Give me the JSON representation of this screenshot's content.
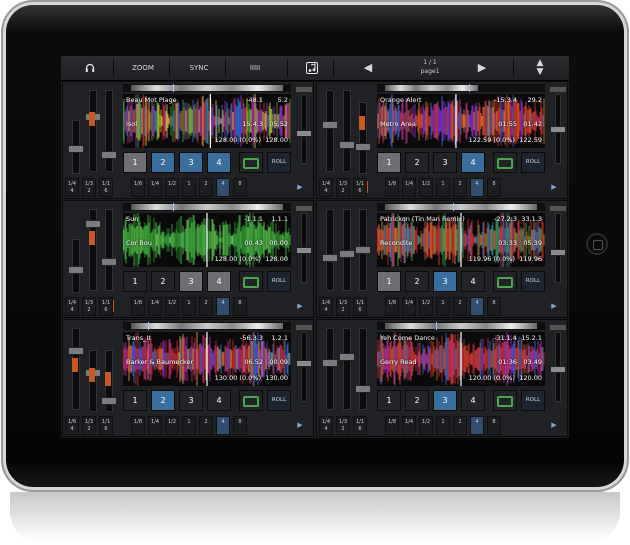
{
  "toolbar": {
    "headphones_icon": "headphones-icon",
    "zoom_label": "ZOOM",
    "sync_label": "SYNC",
    "levels_label": "IIIII",
    "music_icon": "music-note-icon",
    "prev_icon": "triangle-left-icon",
    "page_number": "1 / 1",
    "page_name": "page1",
    "next_icon": "triangle-right-icon",
    "updown_icon": "up-down-arrows-icon"
  },
  "colors": {
    "orange": "#c85a1d",
    "blue_pad": "#3a6e9c",
    "gray_pad": "#6e6f73",
    "loop_green": "#49a64c"
  },
  "decks": [
    {
      "title": "Beau Mot Plage",
      "artist": "Isol",
      "time_elapsed": "-48.1",
      "time_total": "5.2",
      "time_remaining": "15.4.3",
      "time_mid": "05.52",
      "bpm_left": "128.00 (0.0%)",
      "bpm_right": "128.00",
      "pads": [
        "1",
        "2",
        "3",
        "4"
      ],
      "pad_styles": [
        "gray",
        "blue",
        "blue",
        "blue"
      ],
      "roll_label": "ROLL",
      "loop_sizes": [
        "1/4 4",
        "1/3 2",
        "1/1 6",
        "1/8",
        "1/4",
        "1/2",
        "1",
        "2",
        "4",
        "8"
      ],
      "selected_loop_index": 8,
      "headphone_active": false
    },
    {
      "title": "Orange Alert",
      "artist": "Metro Area",
      "time_elapsed": "-15.3.4",
      "time_total": "29.2",
      "time_remaining": "01:55",
      "time_mid": "01.42",
      "bpm_left": "122.59 (0.0%)",
      "bpm_right": "122.59",
      "pads": [
        "1",
        "2",
        "3",
        "4"
      ],
      "pad_styles": [
        "gray",
        "dark",
        "dark",
        "blue"
      ],
      "roll_label": "ROLL",
      "loop_sizes": [
        "1/4 4",
        "1/3 2",
        "1/1 6",
        "1/8",
        "1/4",
        "1/2",
        "1",
        "2",
        "4",
        "8"
      ],
      "selected_loop_index": 8,
      "headphone_active": true
    },
    {
      "title": "Sun",
      "artist": "Cor Bou",
      "time_elapsed": "-1.1.1",
      "time_total": "1.1.1",
      "time_remaining": "00.43",
      "time_mid": "00.00",
      "bpm_left": "128.00 (0.0%)",
      "bpm_right": "128.00",
      "pads": [
        "1",
        "2",
        "3",
        "4"
      ],
      "pad_styles": [
        "dark",
        "dark",
        "gray",
        "gray"
      ],
      "roll_label": "ROLL",
      "loop_sizes": [
        "1/4 4",
        "1/3 2",
        "1/1 6",
        "1/8",
        "1/4",
        "1/2",
        "1",
        "2",
        "4",
        "8"
      ],
      "selected_loop_index": 8,
      "headphone_active": true
    },
    {
      "title": "Patrickon (Tin Man Remix)",
      "artist": "Recondite",
      "time_elapsed": "-27.2.3",
      "time_total": "33.1.3",
      "time_remaining": "03:33",
      "time_mid": "05.39",
      "bpm_left": "119.96 (0.0%)",
      "bpm_right": "119.96",
      "pads": [
        "1",
        "2",
        "3",
        "4"
      ],
      "pad_styles": [
        "gray",
        "dark",
        "blue",
        "dark"
      ],
      "roll_label": "ROLL",
      "loop_sizes": [
        "1/4 4",
        "1/3 2",
        "1/1 6",
        "1/8",
        "1/4",
        "1/2",
        "1",
        "2",
        "4",
        "8"
      ],
      "selected_loop_index": 8,
      "headphone_active": false
    },
    {
      "title": "Trans_It",
      "artist": "Barker & Baumecker",
      "time_elapsed": "-56.3.3",
      "time_total": "1.2.1",
      "time_remaining": "06.52",
      "time_mid": "00.09",
      "bpm_left": "130.00 (0.0%)",
      "bpm_right": "130.00",
      "pads": [
        "1",
        "2",
        "3",
        "4"
      ],
      "pad_styles": [
        "dark",
        "blue",
        "dark",
        "dark"
      ],
      "roll_label": "ROLL",
      "loop_sizes": [
        "1/6 4",
        "1/3 2",
        "1/1 6",
        "1/8",
        "1/4",
        "1/2",
        "1",
        "2",
        "4",
        "8"
      ],
      "selected_loop_index": 8,
      "headphone_active": false
    },
    {
      "title": "Yeh Come Dance",
      "artist": "Gerry Read",
      "time_elapsed": "-31.1.4",
      "time_total": "15.2.1",
      "time_remaining": "01:36",
      "time_mid": "03.49",
      "bpm_left": "120.00 (0.0%)",
      "bpm_right": "120.00",
      "pads": [
        "1",
        "2",
        "3",
        "4"
      ],
      "pad_styles": [
        "dark",
        "dark",
        "blue",
        "dark"
      ],
      "roll_label": "ROLL",
      "loop_sizes": [
        "1/4 4",
        "1/3 2",
        "1/1 6",
        "1/8",
        "1/4",
        "1/2",
        "1",
        "2",
        "4",
        "8"
      ],
      "selected_loop_index": 8,
      "headphone_active": false
    }
  ]
}
